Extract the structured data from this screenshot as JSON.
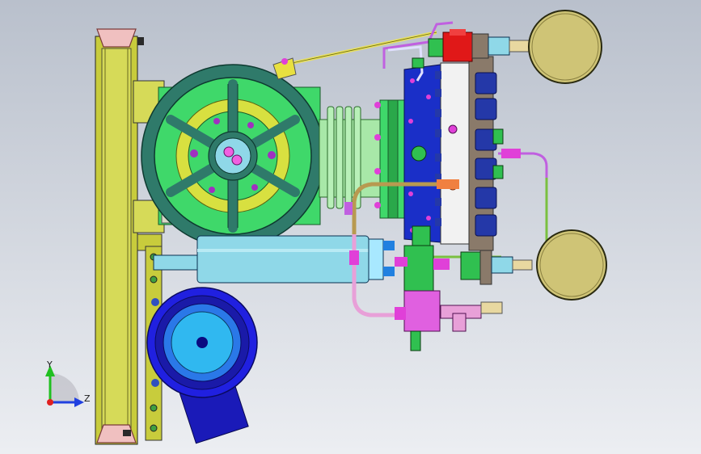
{
  "viewport": {
    "background_top": "#b9c0cc",
    "background_bottom": "#eceef2"
  },
  "model": {
    "colors": {
      "frame_yellow": "#c8cc3c",
      "flywheel_teal": "#2f7a6a",
      "crankcase_green": "#3fd86a",
      "inner_yellow": "#d8e040",
      "head_blue": "#1a2fc8",
      "head_light_blue": "#30b8f0",
      "valve_plate_white": "#f2f2f2",
      "bolt_blue": "#2438a8",
      "fitting_magenta": "#e040d8",
      "pipe_pink": "#e8a0d8",
      "pipe_tan": "#b89a50",
      "pipe_green": "#7ac040",
      "gauge_olive": "#cfc476",
      "fitting_red": "#e01818",
      "cylinder_cyan": "#8fd8e8",
      "motor_blue": "#2020e0"
    },
    "icons": [
      "flywheel-icon",
      "pressure-gauge-icon",
      "motor-icon",
      "coordinate-triad-icon"
    ]
  },
  "triad": {
    "y_label": "Y",
    "z_label": "Z",
    "y_color": "#20c020",
    "z_color": "#2040e0",
    "x_color": "#e02020"
  }
}
